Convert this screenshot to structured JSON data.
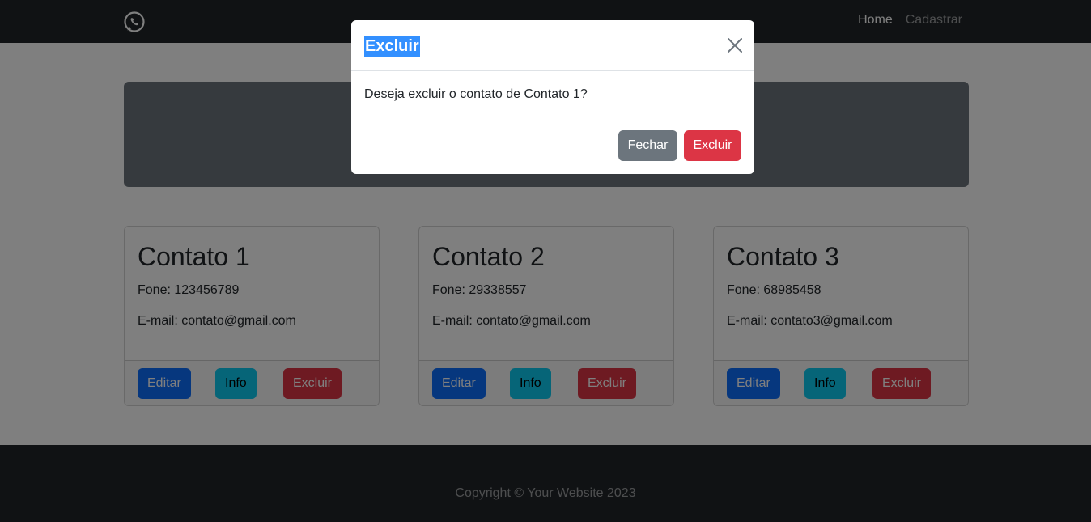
{
  "nav": {
    "links": [
      {
        "label": "Home",
        "active": true
      },
      {
        "label": "Cadastrar",
        "active": false
      }
    ]
  },
  "contacts": [
    {
      "name": "Contato 1",
      "phone_label": "Fone: 123456789",
      "email_label": "E-mail: contato@gmail.com"
    },
    {
      "name": "Contato 2",
      "phone_label": "Fone: 29338557",
      "email_label": "E-mail: contato@gmail.com"
    },
    {
      "name": "Contato 3",
      "phone_label": "Fone: 68985458",
      "email_label": "E-mail: contato3@gmail.com"
    }
  ],
  "card_buttons": {
    "edit": "Editar",
    "info": "Info",
    "delete": "Excluir"
  },
  "footer": {
    "text": "Copyright © Your Website 2023"
  },
  "modal": {
    "title": "Excluir",
    "body": "Deseja excluir o contato de Contato 1?",
    "close_label": "Fechar",
    "confirm_label": "Excluir"
  },
  "colors": {
    "primary": "#0d6efd",
    "info": "#0dcaf0",
    "danger": "#dc3545",
    "secondary": "#6c757d",
    "dark": "#212529"
  },
  "icons": {
    "brand": "whatsapp-icon",
    "close": "close-icon"
  }
}
